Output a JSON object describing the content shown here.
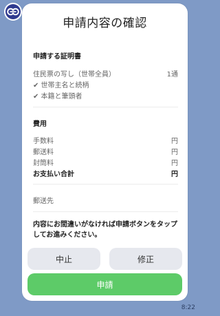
{
  "header": {
    "avatar_icon": "chat-bot-logo-icon"
  },
  "card": {
    "title": "申請内容の確認",
    "certificate_section": {
      "heading": "申請する証明書",
      "item_name": "住民票の写し（世帯全員）",
      "item_count": "1通",
      "options": [
        "✔ 世帯主名と続柄",
        "✔ 本籍と筆頭者"
      ]
    },
    "fees_section": {
      "heading": "費用",
      "rows": [
        {
          "label": "手数料",
          "value": "円"
        },
        {
          "label": "郵送料",
          "value": "円"
        },
        {
          "label": "封筒料",
          "value": "円"
        }
      ],
      "total": {
        "label": "お支払い合計",
        "value": "円"
      }
    },
    "shipping": {
      "label": "郵送先"
    },
    "note": "内容にお間違いがなければ申請ボタンをタップしてお進みください。",
    "buttons": {
      "cancel": "中止",
      "edit": "修正",
      "submit": "申請"
    }
  },
  "timestamp": "8:22",
  "colors": {
    "background": "#7f9ac6",
    "submit": "#5dcb68",
    "secondary_button": "#e6e8ee"
  }
}
